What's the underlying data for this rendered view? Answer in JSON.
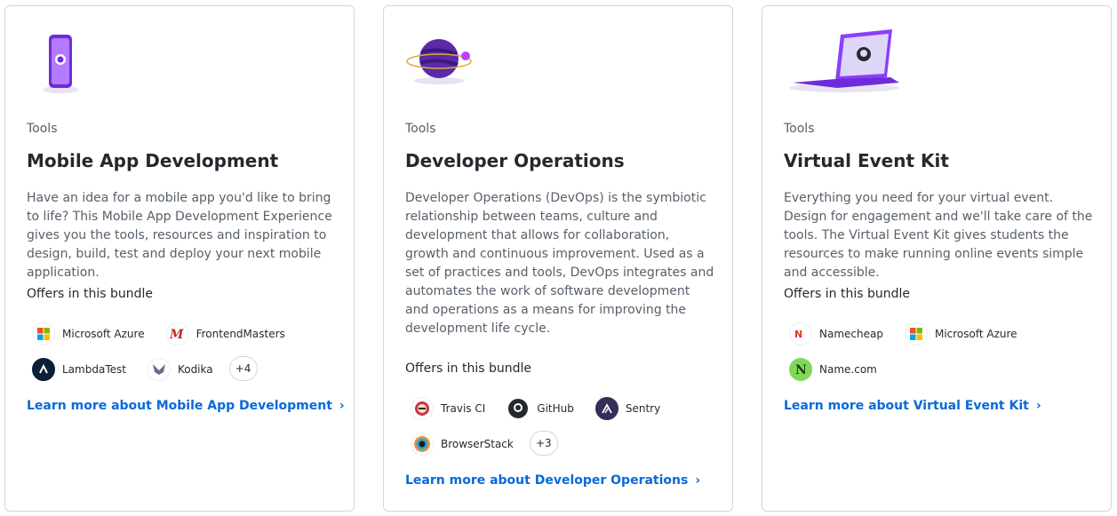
{
  "cards": [
    {
      "eyebrow": "Tools",
      "title": "Mobile App Development",
      "description": "Have an idea for a mobile app you'd like to bring to life? This Mobile App Development Experience gives you the tools, resources and inspiration to design, build, test and deploy your next mobile application.",
      "offers_label": "Offers in this bundle",
      "partners": [
        "Microsoft Azure",
        "FrontendMasters",
        "LambdaTest",
        "Kodika"
      ],
      "more": "+4",
      "link": "Learn more about Mobile App Development"
    },
    {
      "eyebrow": "Tools",
      "title": "Developer Operations",
      "description": "Developer Operations (DevOps) is the symbiotic relationship between teams, culture and development that allows for collaboration, growth and continuous improvement. Used as a set of practices and tools, DevOps integrates and automates the work of software development and operations as a means for improving the development life cycle.",
      "offers_label": "Offers in this bundle",
      "partners": [
        "Travis CI",
        "GitHub",
        "Sentry",
        "BrowserStack"
      ],
      "more": "+3",
      "link": "Learn more about Developer Operations"
    },
    {
      "eyebrow": "Tools",
      "title": "Virtual Event Kit",
      "description": "Everything you need for your virtual event. Design for engagement and we'll take care of the tools. The Virtual Event Kit gives students the resources to make running online events simple and accessible.",
      "offers_label": "Offers in this bundle",
      "partners": [
        "Namecheap",
        "Microsoft Azure",
        "Name.com"
      ],
      "more": "",
      "link": "Learn more about Virtual Event Kit"
    }
  ],
  "colors": {
    "link": "#0969da",
    "border": "#d0d7de",
    "muted": "#57606a",
    "accent_purple": "#8a3ffc"
  },
  "icons": {
    "hero": [
      "mobile-phone-octocat-illustration",
      "planet-octocat-illustration",
      "laptop-octocat-illustration"
    ],
    "chevron": "chevron-right-icon"
  }
}
